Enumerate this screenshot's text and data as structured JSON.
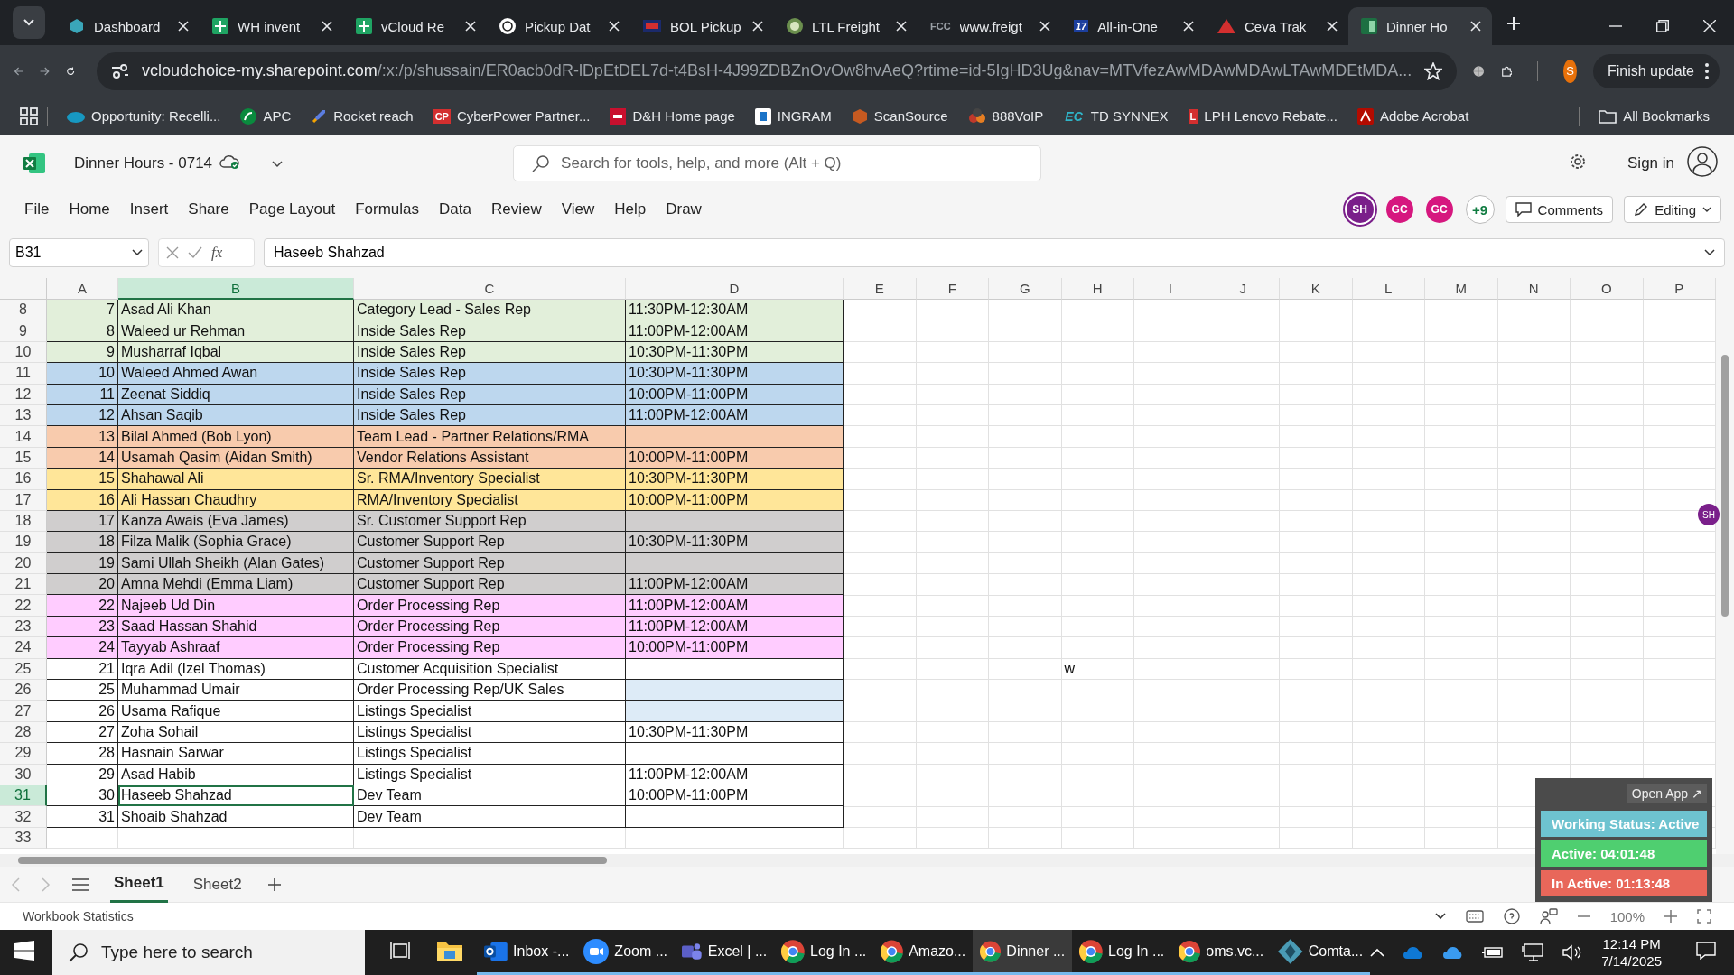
{
  "browser": {
    "tabs": [
      {
        "title": "Dashboard",
        "selected": false
      },
      {
        "title": "WH invent",
        "selected": false
      },
      {
        "title": "vCloud Re",
        "selected": false
      },
      {
        "title": "Pickup Dat",
        "selected": false
      },
      {
        "title": "BOL Pickup",
        "selected": false
      },
      {
        "title": "LTL Freight",
        "selected": false
      },
      {
        "title": "www.freigt",
        "selected": false,
        "icon_text": "FCC"
      },
      {
        "title": "All-in-One",
        "selected": false,
        "icon_text": "17"
      },
      {
        "title": "Ceva Trak",
        "selected": false
      },
      {
        "title": "Dinner Ho",
        "selected": true
      }
    ],
    "url_host": "vcloudchoice-my.sharepoint.com",
    "url_rest": "/:x:/p/shussain/ER0acb0dR-lDpEtDEL7d-t4BsH-4J99ZDBZnOvOw8hvAeQ?rtime=id-5IgHD3Ug&nav=MTVfezAwMDAwMDAwLTAwMDEtMDA...",
    "profile_initial": "S",
    "update_button": "Finish update",
    "bookmarks": [
      {
        "label": "Opportunity: Recelli..."
      },
      {
        "label": "APC"
      },
      {
        "label": "Rocket reach"
      },
      {
        "label": "CyberPower Partner...",
        "icon_text": "CP"
      },
      {
        "label": "D&H Home page"
      },
      {
        "label": "INGRAM"
      },
      {
        "label": "ScanSource"
      },
      {
        "label": "888VoIP"
      },
      {
        "label": "TD SYNNEX",
        "icon_text": "EC"
      },
      {
        "label": "LPH Lenovo Rebate...",
        "icon_text": "L"
      },
      {
        "label": "Adobe Acrobat"
      }
    ],
    "all_bookmarks": "All Bookmarks"
  },
  "excel": {
    "title": "Dinner Hours - 0714",
    "search_placeholder": "Search for tools, help, and more (Alt + Q)",
    "sign_in": "Sign in",
    "menu": [
      "File",
      "Home",
      "Insert",
      "Share",
      "Page Layout",
      "Formulas",
      "Data",
      "Review",
      "View",
      "Help",
      "Draw"
    ],
    "collaborators": [
      {
        "initials": "SH",
        "color": "#7a1f8a"
      },
      {
        "initials": "GC",
        "color": "#d6177f"
      },
      {
        "initials": "GC",
        "color": "#d6177f"
      }
    ],
    "more_collaborators": "+9",
    "comments": "Comments",
    "editing": "Editing",
    "name_box": "B31",
    "fx_label": "fx",
    "formula": "Haseeb Shahzad",
    "columns": [
      {
        "label": "A",
        "selected": false
      },
      {
        "label": "B",
        "selected": true
      },
      {
        "label": "C",
        "selected": false
      },
      {
        "label": "D",
        "selected": false
      },
      {
        "label": "E",
        "selected": false
      },
      {
        "label": "F",
        "selected": false
      },
      {
        "label": "G",
        "selected": false
      },
      {
        "label": "H",
        "selected": false
      },
      {
        "label": "I",
        "selected": false
      },
      {
        "label": "J",
        "selected": false
      },
      {
        "label": "K",
        "selected": false
      },
      {
        "label": "L",
        "selected": false
      },
      {
        "label": "M",
        "selected": false
      },
      {
        "label": "N",
        "selected": false
      },
      {
        "label": "O",
        "selected": false
      },
      {
        "label": "P",
        "selected": false
      }
    ],
    "rows": [
      {
        "row": "8",
        "a": "7",
        "b": "Asad Ali Khan",
        "c": "Category Lead - Sales Rep",
        "d": "11:30PM-12:30AM",
        "color": "#e2efda",
        "selected": false
      },
      {
        "row": "9",
        "a": "8",
        "b": "Waleed ur Rehman",
        "c": "Inside Sales Rep",
        "d": "11:00PM-12:00AM",
        "color": "#e2efda",
        "selected": false
      },
      {
        "row": "10",
        "a": "9",
        "b": "Musharraf Iqbal",
        "c": "Inside Sales Rep",
        "d": "10:30PM-11:30PM",
        "color": "#e2efda",
        "selected": false
      },
      {
        "row": "11",
        "a": "10",
        "b": "Waleed Ahmed Awan",
        "c": "Inside Sales Rep",
        "d": "10:30PM-11:30PM",
        "color": "#bdd7ee",
        "selected": false
      },
      {
        "row": "12",
        "a": "11",
        "b": "Zeenat Siddiq",
        "c": "Inside Sales Rep",
        "d": "10:00PM-11:00PM",
        "color": "#bdd7ee",
        "selected": false
      },
      {
        "row": "13",
        "a": "12",
        "b": "Ahsan Saqib",
        "c": "Inside Sales Rep",
        "d": "11:00PM-12:00AM",
        "color": "#bdd7ee",
        "selected": false
      },
      {
        "row": "14",
        "a": "13",
        "b": "Bilal Ahmed (Bob Lyon)",
        "c": "Team Lead - Partner Relations/RMA",
        "color": "#f8cbad",
        "selected": false
      },
      {
        "row": "15",
        "a": "14",
        "b": "Usamah Qasim (Aidan Smith)",
        "c": "Vendor Relations Assistant",
        "d": "10:00PM-11:00PM",
        "color": "#f8cbad",
        "selected": false
      },
      {
        "row": "16",
        "a": "15",
        "b": "Shahawal Ali",
        "c": "Sr. RMA/Inventory Specialist",
        "d": "10:30PM-11:30PM",
        "color": "#ffe699",
        "selected": false
      },
      {
        "row": "17",
        "a": "16",
        "b": "Ali Hassan Chaudhry",
        "c": "RMA/Inventory Specialist",
        "d": "10:00PM-11:00PM",
        "color": "#ffe699",
        "selected": false
      },
      {
        "row": "18",
        "a": "17",
        "b": "Kanza Awais (Eva James)",
        "c": "Sr. Customer Support Rep",
        "color": "#d0cece",
        "selected": false
      },
      {
        "row": "19",
        "a": "18",
        "b": "Filza Malik (Sophia Grace)",
        "c": "Customer Support Rep",
        "d": "10:30PM-11:30PM",
        "color": "#d0cece",
        "selected": false
      },
      {
        "row": "20",
        "a": "19",
        "b": "Sami Ullah Sheikh (Alan Gates)",
        "c": "Customer Support Rep",
        "color": "#d0cece",
        "selected": false
      },
      {
        "row": "21",
        "a": "20",
        "b": "Amna Mehdi (Emma Liam)",
        "c": "Customer Support Rep",
        "d": "11:00PM-12:00AM",
        "color": "#d0cece",
        "selected": false
      },
      {
        "row": "22",
        "a": "22",
        "b": "Najeeb Ud Din",
        "c": "Order Processing Rep",
        "d": "11:00PM-12:00AM",
        "color": "#ffccff",
        "selected": false
      },
      {
        "row": "23",
        "a": "23",
        "b": "Saad Hassan Shahid",
        "c": "Order Processing Rep",
        "d": "11:00PM-12:00AM",
        "color": "#ffccff",
        "selected": false
      },
      {
        "row": "24",
        "a": "24",
        "b": "Tayyab Ashraaf",
        "c": "Order Processing Rep",
        "d": "10:00PM-11:00PM",
        "color": "#ffccff",
        "selected": false
      },
      {
        "row": "25",
        "a": "21",
        "b": "Iqra Adil (Izel Thomas)",
        "c": "Customer Acquisition Specialist",
        "h": "w",
        "color": "#ffffff",
        "selected": false
      },
      {
        "row": "26",
        "a": "25",
        "b": "Muhammad Umair",
        "c": "Order Processing Rep/UK Sales",
        "color": "#ffffff",
        "d_cell": {
          "color": "#ddebf7"
        },
        "selected": false
      },
      {
        "row": "27",
        "a": "26",
        "b": "Usama Rafique",
        "c": "Listings Specialist",
        "color": "#ffffff",
        "d_cell": {
          "color": "#ddebf7"
        },
        "selected": false
      },
      {
        "row": "28",
        "a": "27",
        "b": "Zoha Sohail",
        "c": "Listings Specialist",
        "d": "10:30PM-11:30PM",
        "color": "#ffffff",
        "selected": false
      },
      {
        "row": "29",
        "a": "28",
        "b": "Hasnain Sarwar",
        "c": "Listings Specialist",
        "color": "#ffffff",
        "selected": false
      },
      {
        "row": "30",
        "a": "29",
        "b": "Asad Habib",
        "c": "Listings Specialist",
        "d": "11:00PM-12:00AM",
        "color": "#ffffff",
        "selected": false
      },
      {
        "row": "31",
        "a": "30",
        "b": "Haseeb Shahzad",
        "c": "Dev Team",
        "d": "10:00PM-11:00PM",
        "color": "#ffffff",
        "selected": true
      },
      {
        "row": "32",
        "a": "31",
        "b": "Shoaib Shahzad",
        "c": "Dev Team",
        "color": "#ffffff",
        "selected": false
      },
      {
        "row": "33",
        "selected": false
      }
    ],
    "presence_marker": "SH",
    "sheets": [
      {
        "label": "Sheet1",
        "selected": true
      },
      {
        "label": "Sheet2",
        "selected": false
      }
    ],
    "status_left": "Workbook Statistics",
    "zoom": "100%"
  },
  "tracker": {
    "open_app": "Open App ↗",
    "items": [
      {
        "label": "Working Status: Active",
        "color": "#6ec3d0"
      },
      {
        "label": "Active: 04:01:48",
        "color": "#4fcf70"
      },
      {
        "label": "In Active: 01:13:48",
        "color": "#e8675a"
      }
    ]
  },
  "taskbar": {
    "search_placeholder": "Type here to search",
    "apps": [
      {
        "label": "Inbox -...",
        "selected": false
      },
      {
        "label": "Zoom ...",
        "selected": false
      },
      {
        "label": "Excel | ...",
        "selected": false
      },
      {
        "label": "Log In ...",
        "selected": false
      },
      {
        "label": "Amazo...",
        "selected": false
      },
      {
        "label": "Dinner ...",
        "selected": true
      },
      {
        "label": "Log In ...",
        "selected": false
      },
      {
        "label": "oms.vc...",
        "selected": false
      },
      {
        "label": "Comta...",
        "selected": false
      }
    ],
    "time": "12:14 PM",
    "date": "7/14/2025"
  }
}
